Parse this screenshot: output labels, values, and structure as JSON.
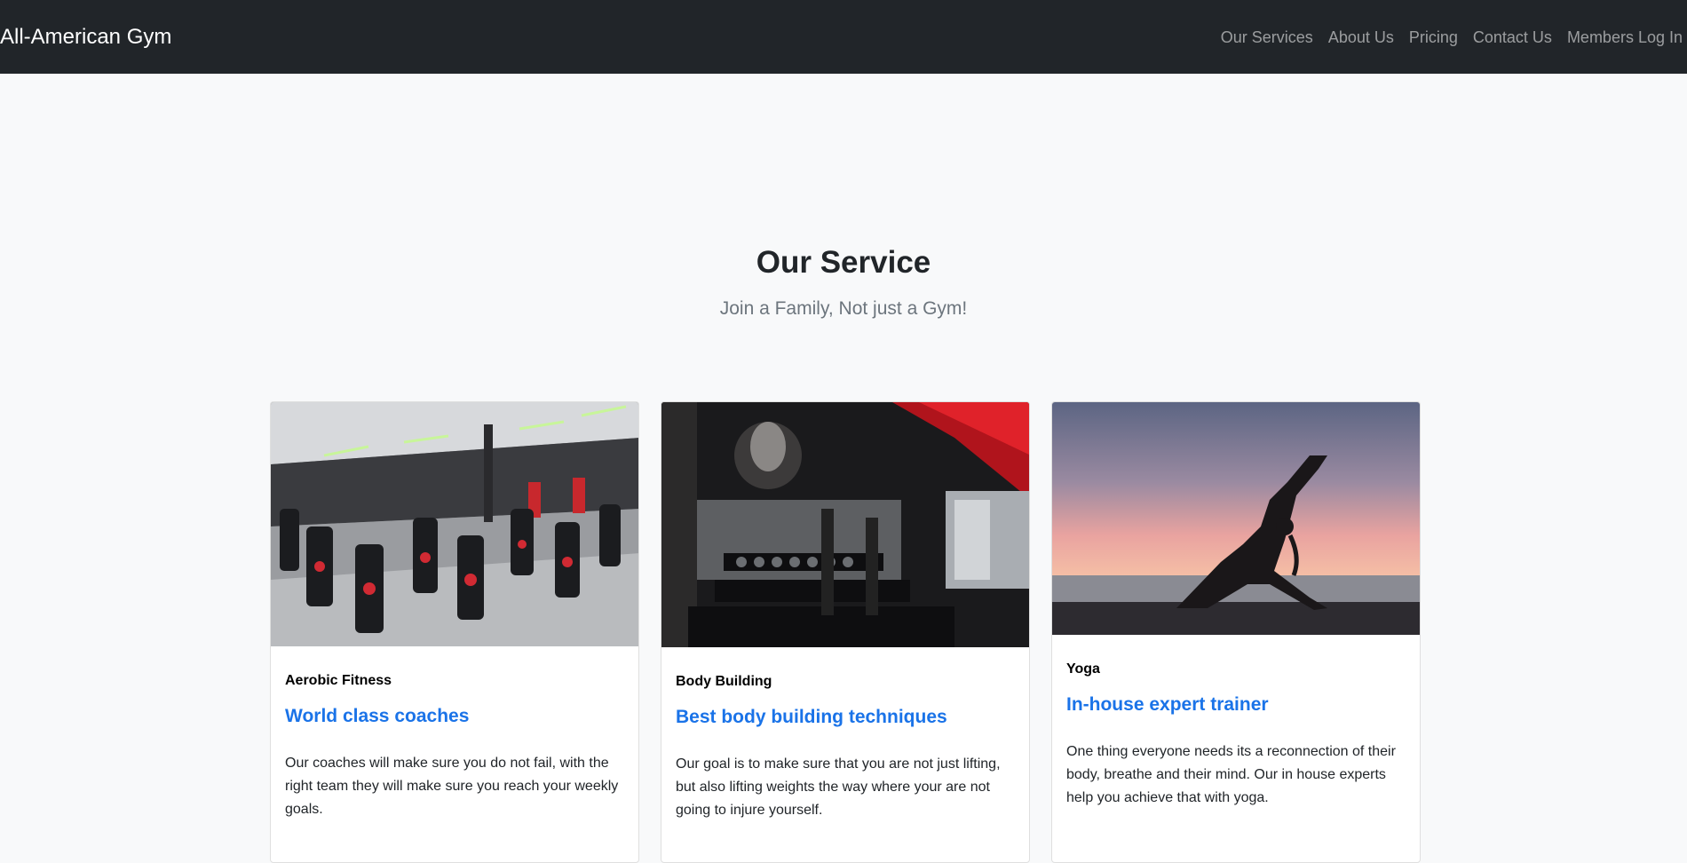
{
  "navbar": {
    "brand": "All-American Gym",
    "links": [
      "Our Services",
      "About Us",
      "Pricing",
      "Contact Us",
      "Members Log In"
    ]
  },
  "section": {
    "title": "Our Service",
    "subtitle": "Join a Family, Not just a Gym!"
  },
  "cards": [
    {
      "image": "spin-bike-studio-image",
      "subtitle": "Aerobic Fitness",
      "title": "World class coaches",
      "text": "Our coaches will make sure you do not fail, with the right team they will make sure you reach your weekly goals."
    },
    {
      "image": "weight-room-image",
      "subtitle": "Body Building",
      "title": "Best body building techniques",
      "text": "Our goal is to make sure that you are not just lifting, but also lifting weights the way where your are not going to injure yourself."
    },
    {
      "image": "yoga-sunset-image",
      "subtitle": "Yoga",
      "title": "In-house expert trainer",
      "text": "One thing everyone needs its a reconnection of their body, breathe and their mind. Our in house experts help you achieve that with yoga."
    }
  ]
}
